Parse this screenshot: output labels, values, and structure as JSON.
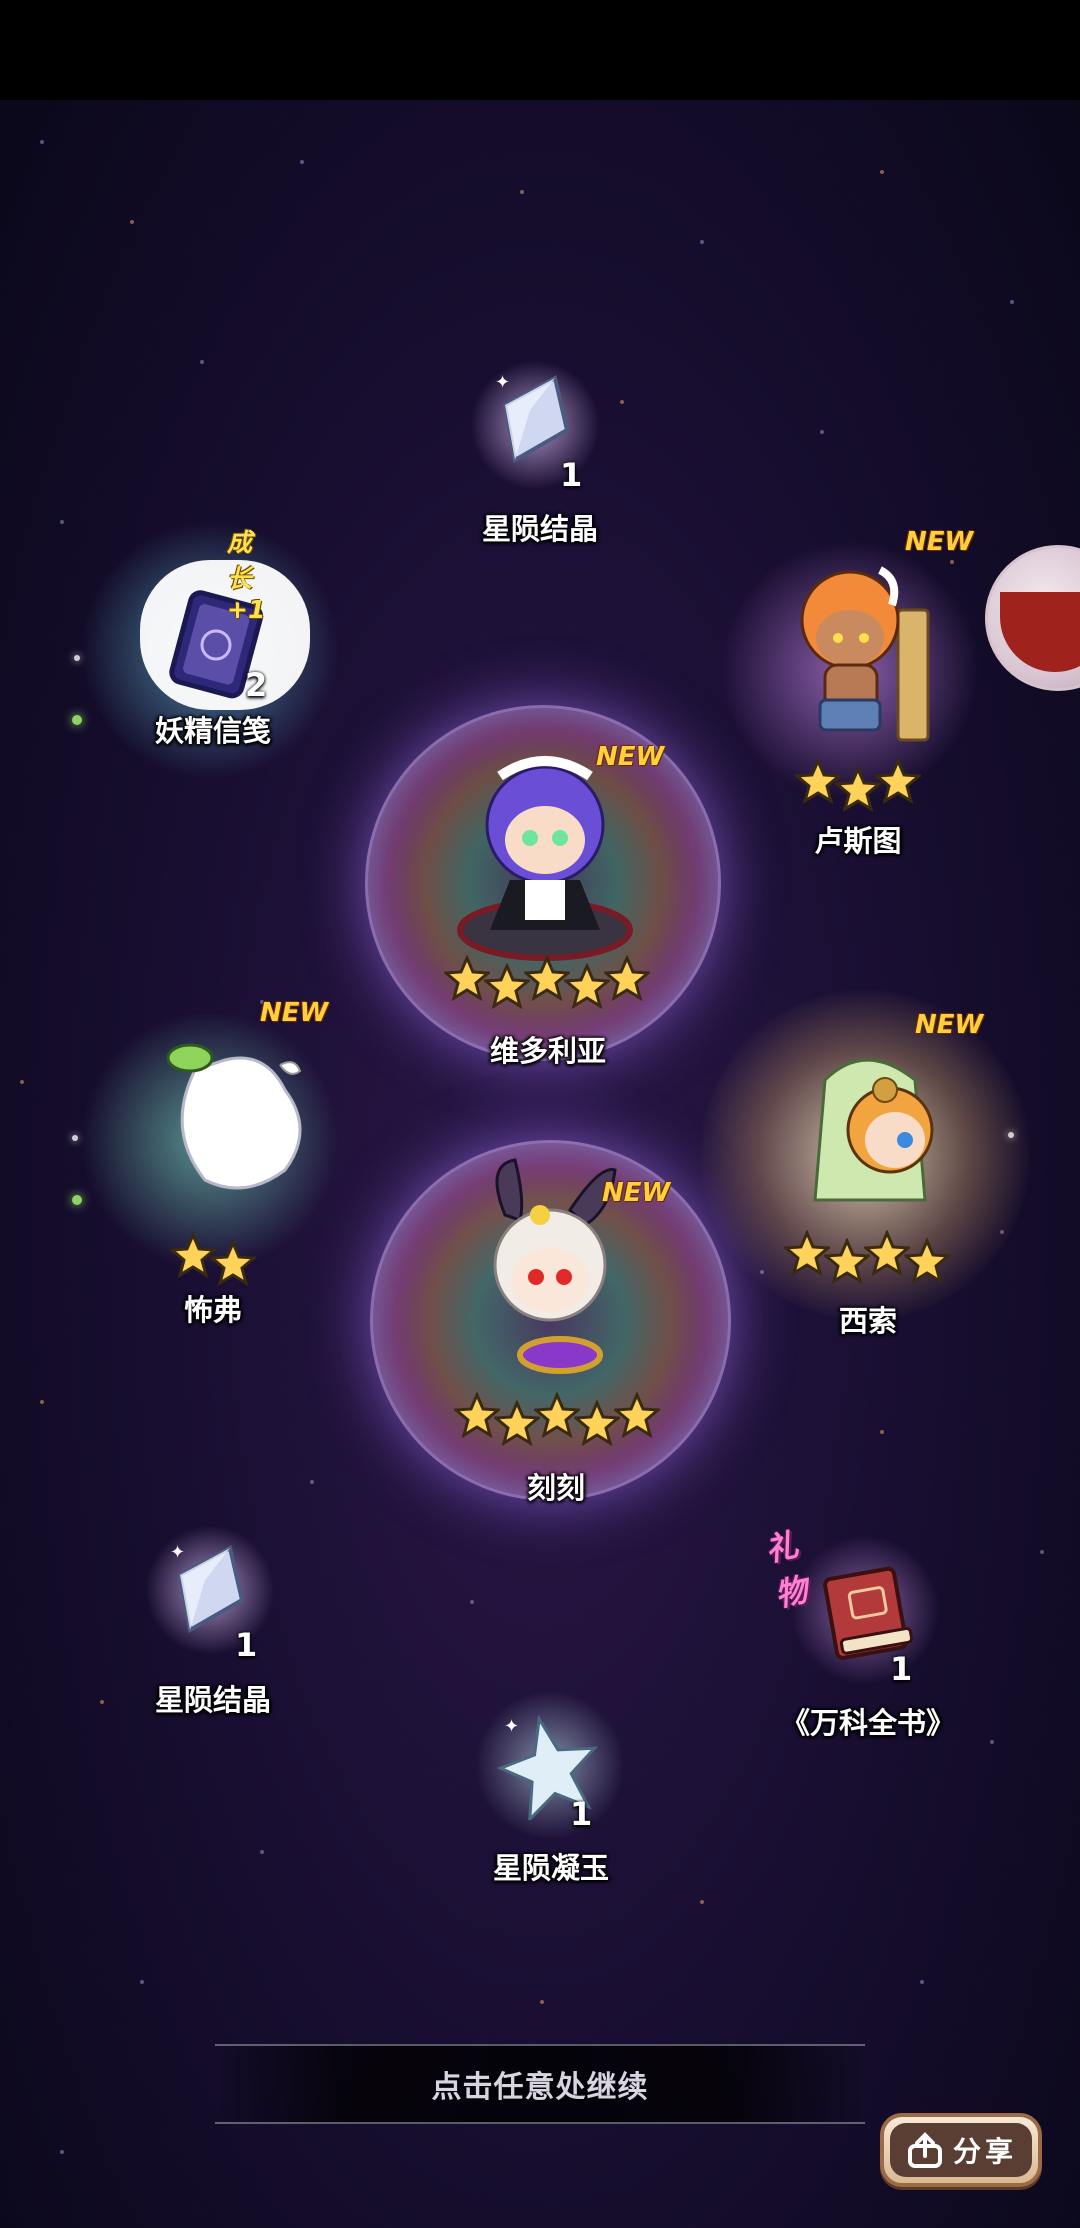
{
  "rewards": {
    "crystal_top": {
      "name": "星陨结晶",
      "count": "1"
    },
    "fairy_letter": {
      "name": "妖精信笺",
      "count": "2",
      "growth": "成长+1"
    },
    "lustu": {
      "name": "卢斯图",
      "badge": "NEW",
      "stars": 3
    },
    "victoria": {
      "name": "维多利亚",
      "badge": "NEW",
      "stars": 5
    },
    "fufu": {
      "name": "怖弗",
      "badge": "NEW",
      "stars": 2
    },
    "xisuo": {
      "name": "西索",
      "badge": "NEW",
      "stars": 4
    },
    "keke": {
      "name": "刻刻",
      "badge": "NEW",
      "stars": 5
    },
    "crystal_left": {
      "name": "星陨结晶",
      "count": "1"
    },
    "encyclopedia": {
      "name": "《万科全书》",
      "count": "1",
      "tag": "礼物"
    },
    "jade": {
      "name": "星陨凝玉",
      "count": "1"
    }
  },
  "continue_prompt": "点击任意处继续",
  "share_button": "分享",
  "colors": {
    "new_badge": "#ffcf3d",
    "star": "#ffd35a",
    "gift_tag": "#ff7fd4"
  }
}
